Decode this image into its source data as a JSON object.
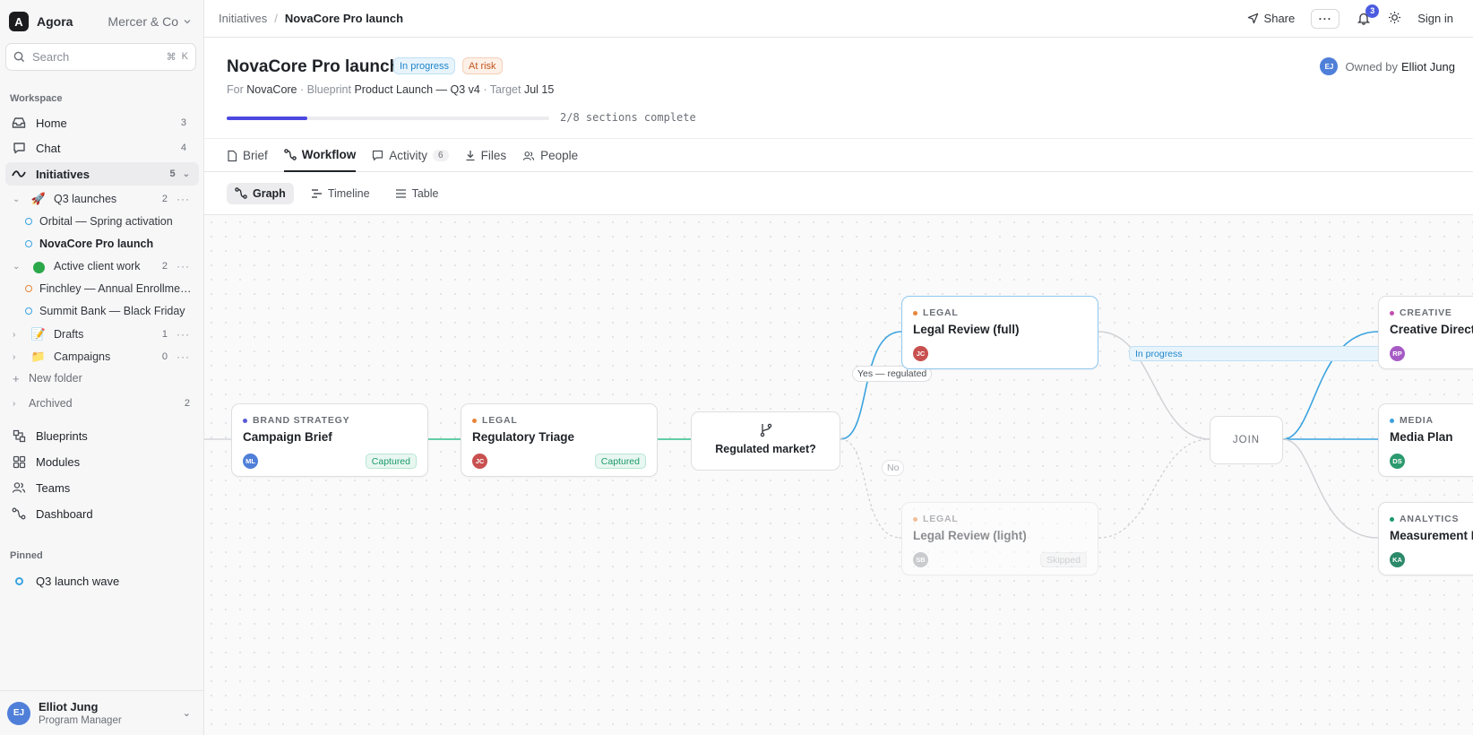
{
  "app": {
    "logo_letter": "A",
    "name": "Agora",
    "org": "Mercer & Co"
  },
  "search": {
    "placeholder": "Search",
    "kbd1": "⌘",
    "kbd2": "K"
  },
  "sidebar": {
    "workspace_label": "Workspace",
    "nav": [
      {
        "label": "Home",
        "count": "3"
      },
      {
        "label": "Chat",
        "count": "4"
      },
      {
        "label": "Initiatives",
        "count": "5"
      }
    ],
    "folders": [
      {
        "emoji": "🚀",
        "label": "Q3 launches",
        "count": "2"
      },
      {
        "emoji": "🟢",
        "label": "Active client work",
        "count": "2"
      },
      {
        "emoji": "📝",
        "label": "Drafts",
        "count": "1"
      },
      {
        "emoji": "📁",
        "label": "Campaigns",
        "count": "0"
      }
    ],
    "leaves": [
      "Orbital — Spring activation",
      "NovaCore Pro launch",
      "Finchley — Annual Enrollme…",
      "Summit Bank — Black Friday"
    ],
    "new_folder": "New folder",
    "archived": {
      "label": "Archived",
      "count": "2"
    },
    "lower_nav": [
      "Blueprints",
      "Modules",
      "Teams",
      "Dashboard"
    ],
    "pinned_label": "Pinned",
    "pinned_item": "Q3 launch wave"
  },
  "user": {
    "initials": "EJ",
    "name": "Elliot Jung",
    "role": "Program Manager"
  },
  "topbar": {
    "crumb_parent": "Initiatives",
    "crumb_sep": "/",
    "crumb_current": "NovaCore Pro launch",
    "share": "Share",
    "notifications": "3",
    "signin": "Sign in"
  },
  "header": {
    "title": "NovaCore Pro launch",
    "status": "In progress",
    "risk": "At risk",
    "owner_initials": "EJ",
    "owner_prefix": "Owned by",
    "owner_name": "Elliot Jung",
    "meta_for": "For",
    "client": "NovaCore",
    "meta_blueprint": "· Blueprint",
    "blueprint": "Product Launch — Q3 v4",
    "meta_target": "· Target",
    "target": "Jul 15",
    "progress_fraction": 0.25,
    "progress_text": "2/8 sections complete"
  },
  "tabs": [
    {
      "label": "Brief"
    },
    {
      "label": "Workflow"
    },
    {
      "label": "Activity",
      "count": "6"
    },
    {
      "label": "Files"
    },
    {
      "label": "People"
    }
  ],
  "views": [
    "Graph",
    "Timeline",
    "Table"
  ],
  "graph": {
    "nodes": [
      {
        "category": "BRAND STRATEGY",
        "name": "Campaign Brief",
        "initials": "ML",
        "status": "Captured"
      },
      {
        "category": "LEGAL",
        "name": "Regulatory Triage",
        "initials": "JC",
        "status": "Captured"
      },
      {
        "category": "LEGAL",
        "name": "Legal Review (full)",
        "initials": "JC",
        "status": "In progress"
      },
      {
        "category": "LEGAL",
        "name": "Legal Review (light)",
        "initials": "SB",
        "status": "Skipped"
      },
      {
        "category": "CREATIVE",
        "name": "Creative Directi",
        "initials": "RP"
      },
      {
        "category": "MEDIA",
        "name": "Media Plan",
        "initials": "DS"
      },
      {
        "category": "ANALYTICS",
        "name": "Measurement P",
        "initials": "KA"
      }
    ],
    "decision": "Regulated market?",
    "edge_yes": "Yes — regulated",
    "edge_no": "No",
    "join": "JOIN",
    "colors": {
      "brand": "#5b5bd6",
      "legal": "#e8853a",
      "creative": "#c24fb0",
      "media": "#3aa3e0",
      "analytics": "#1c9a6a",
      "edge_active": "#3aa3e0",
      "edge_done": "#2fbf8a"
    }
  }
}
